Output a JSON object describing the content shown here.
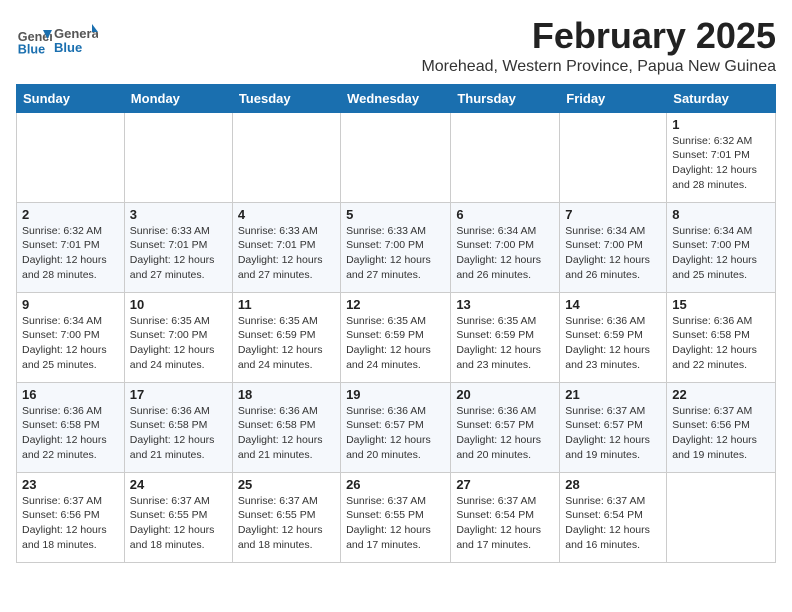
{
  "header": {
    "logo_general": "General",
    "logo_blue": "Blue",
    "month_title": "February 2025",
    "location": "Morehead, Western Province, Papua New Guinea"
  },
  "weekdays": [
    "Sunday",
    "Monday",
    "Tuesday",
    "Wednesday",
    "Thursday",
    "Friday",
    "Saturday"
  ],
  "weeks": [
    [
      {
        "day": "",
        "detail": ""
      },
      {
        "day": "",
        "detail": ""
      },
      {
        "day": "",
        "detail": ""
      },
      {
        "day": "",
        "detail": ""
      },
      {
        "day": "",
        "detail": ""
      },
      {
        "day": "",
        "detail": ""
      },
      {
        "day": "1",
        "detail": "Sunrise: 6:32 AM\nSunset: 7:01 PM\nDaylight: 12 hours\nand 28 minutes."
      }
    ],
    [
      {
        "day": "2",
        "detail": "Sunrise: 6:32 AM\nSunset: 7:01 PM\nDaylight: 12 hours\nand 28 minutes."
      },
      {
        "day": "3",
        "detail": "Sunrise: 6:33 AM\nSunset: 7:01 PM\nDaylight: 12 hours\nand 27 minutes."
      },
      {
        "day": "4",
        "detail": "Sunrise: 6:33 AM\nSunset: 7:01 PM\nDaylight: 12 hours\nand 27 minutes."
      },
      {
        "day": "5",
        "detail": "Sunrise: 6:33 AM\nSunset: 7:00 PM\nDaylight: 12 hours\nand 27 minutes."
      },
      {
        "day": "6",
        "detail": "Sunrise: 6:34 AM\nSunset: 7:00 PM\nDaylight: 12 hours\nand 26 minutes."
      },
      {
        "day": "7",
        "detail": "Sunrise: 6:34 AM\nSunset: 7:00 PM\nDaylight: 12 hours\nand 26 minutes."
      },
      {
        "day": "8",
        "detail": "Sunrise: 6:34 AM\nSunset: 7:00 PM\nDaylight: 12 hours\nand 25 minutes."
      }
    ],
    [
      {
        "day": "9",
        "detail": "Sunrise: 6:34 AM\nSunset: 7:00 PM\nDaylight: 12 hours\nand 25 minutes."
      },
      {
        "day": "10",
        "detail": "Sunrise: 6:35 AM\nSunset: 7:00 PM\nDaylight: 12 hours\nand 24 minutes."
      },
      {
        "day": "11",
        "detail": "Sunrise: 6:35 AM\nSunset: 6:59 PM\nDaylight: 12 hours\nand 24 minutes."
      },
      {
        "day": "12",
        "detail": "Sunrise: 6:35 AM\nSunset: 6:59 PM\nDaylight: 12 hours\nand 24 minutes."
      },
      {
        "day": "13",
        "detail": "Sunrise: 6:35 AM\nSunset: 6:59 PM\nDaylight: 12 hours\nand 23 minutes."
      },
      {
        "day": "14",
        "detail": "Sunrise: 6:36 AM\nSunset: 6:59 PM\nDaylight: 12 hours\nand 23 minutes."
      },
      {
        "day": "15",
        "detail": "Sunrise: 6:36 AM\nSunset: 6:58 PM\nDaylight: 12 hours\nand 22 minutes."
      }
    ],
    [
      {
        "day": "16",
        "detail": "Sunrise: 6:36 AM\nSunset: 6:58 PM\nDaylight: 12 hours\nand 22 minutes."
      },
      {
        "day": "17",
        "detail": "Sunrise: 6:36 AM\nSunset: 6:58 PM\nDaylight: 12 hours\nand 21 minutes."
      },
      {
        "day": "18",
        "detail": "Sunrise: 6:36 AM\nSunset: 6:58 PM\nDaylight: 12 hours\nand 21 minutes."
      },
      {
        "day": "19",
        "detail": "Sunrise: 6:36 AM\nSunset: 6:57 PM\nDaylight: 12 hours\nand 20 minutes."
      },
      {
        "day": "20",
        "detail": "Sunrise: 6:36 AM\nSunset: 6:57 PM\nDaylight: 12 hours\nand 20 minutes."
      },
      {
        "day": "21",
        "detail": "Sunrise: 6:37 AM\nSunset: 6:57 PM\nDaylight: 12 hours\nand 19 minutes."
      },
      {
        "day": "22",
        "detail": "Sunrise: 6:37 AM\nSunset: 6:56 PM\nDaylight: 12 hours\nand 19 minutes."
      }
    ],
    [
      {
        "day": "23",
        "detail": "Sunrise: 6:37 AM\nSunset: 6:56 PM\nDaylight: 12 hours\nand 18 minutes."
      },
      {
        "day": "24",
        "detail": "Sunrise: 6:37 AM\nSunset: 6:55 PM\nDaylight: 12 hours\nand 18 minutes."
      },
      {
        "day": "25",
        "detail": "Sunrise: 6:37 AM\nSunset: 6:55 PM\nDaylight: 12 hours\nand 18 minutes."
      },
      {
        "day": "26",
        "detail": "Sunrise: 6:37 AM\nSunset: 6:55 PM\nDaylight: 12 hours\nand 17 minutes."
      },
      {
        "day": "27",
        "detail": "Sunrise: 6:37 AM\nSunset: 6:54 PM\nDaylight: 12 hours\nand 17 minutes."
      },
      {
        "day": "28",
        "detail": "Sunrise: 6:37 AM\nSunset: 6:54 PM\nDaylight: 12 hours\nand 16 minutes."
      },
      {
        "day": "",
        "detail": ""
      }
    ]
  ]
}
